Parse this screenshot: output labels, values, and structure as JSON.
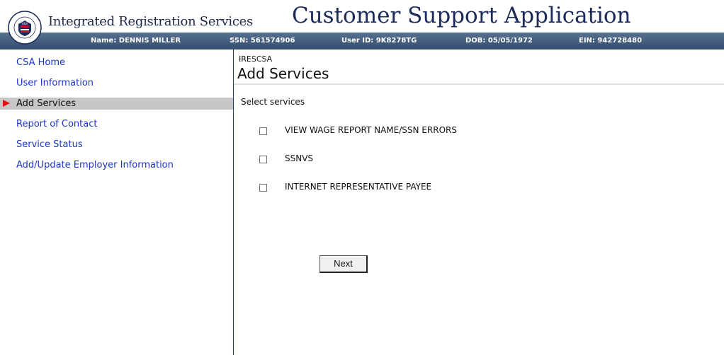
{
  "header": {
    "org_name": "Integrated Registration Services",
    "app_title": "Customer Support Application",
    "seal_text": "SOCIAL SECURITY ADMINISTRATION USA"
  },
  "user_info": {
    "name": "Name: DENNIS MILLER",
    "ssn": "SSN: 561574906",
    "user_id": "User ID: 9K8278TG",
    "dob": "DOB: 05/05/1972",
    "ein": "EIN: 942728480"
  },
  "sidebar": {
    "items": [
      {
        "label": "CSA Home",
        "active": false
      },
      {
        "label": "User Information",
        "active": false
      },
      {
        "label": "Add Services",
        "active": true
      },
      {
        "label": "Report of Contact",
        "active": false
      },
      {
        "label": "Service Status",
        "active": false
      },
      {
        "label": "Add/Update Employer Information",
        "active": false
      }
    ]
  },
  "main": {
    "breadcrumb": "IRESCSA",
    "title": "Add Services",
    "subhead": "Select services",
    "services": [
      {
        "label": "VIEW WAGE REPORT NAME/SSN ERRORS",
        "checked": false
      },
      {
        "label": "SSNVS",
        "checked": false
      },
      {
        "label": "INTERNET REPRESENTATIVE PAYEE",
        "checked": false
      }
    ],
    "next_label": "Next"
  },
  "colors": {
    "accent_red": "#e01010",
    "nav_link": "#1b35c7",
    "infobar": "#344d6e",
    "title_navy": "#1b2a59"
  }
}
